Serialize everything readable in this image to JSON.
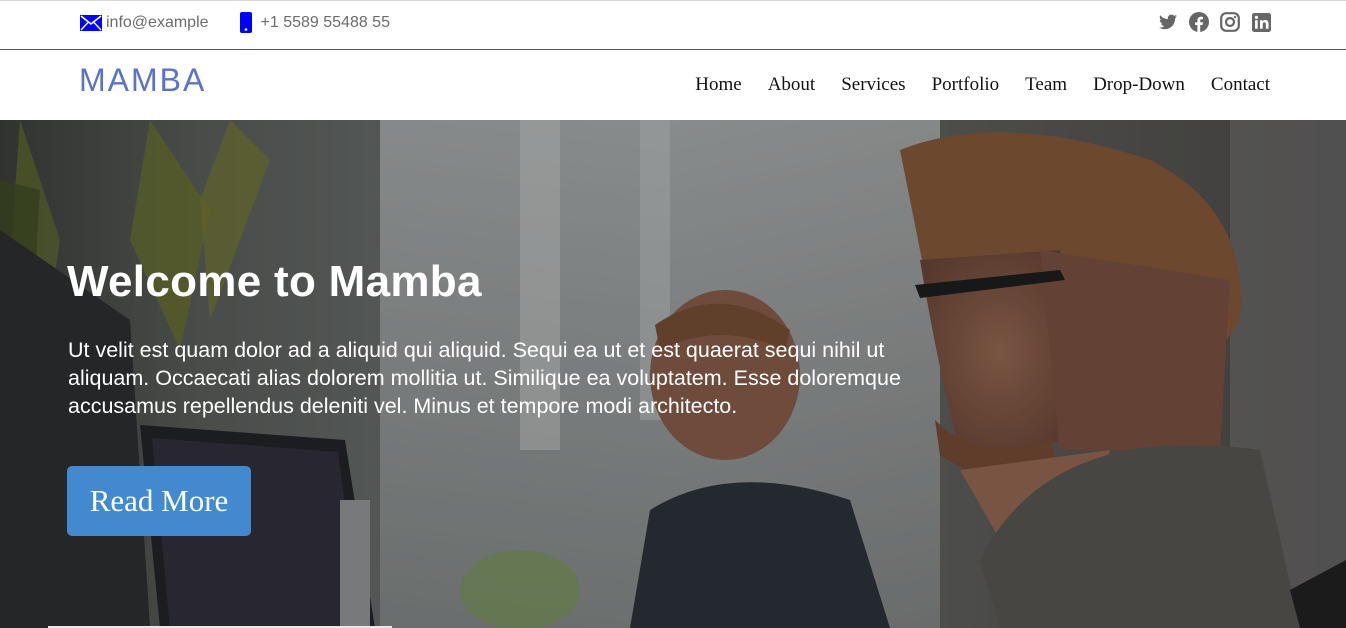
{
  "topbar": {
    "email": "info@example",
    "phone": "+1 5589 55488 55",
    "icons": [
      "envelope-icon",
      "phone-icon"
    ],
    "social": [
      "twitter-icon",
      "facebook-icon",
      "instagram-icon",
      "linkedin-icon"
    ]
  },
  "header": {
    "logo": "MAMBA",
    "nav": [
      "Home",
      "About",
      "Services",
      "Portfolio",
      "Team",
      "Drop-Down",
      "Contact"
    ]
  },
  "hero": {
    "title": "Welcome to Mamba",
    "text": "Ut velit est quam dolor ad a aliquid qui aliquid. Sequi ea ut et est quaerat sequi nihil ut aliquam. Occaecati alias dolorem mollitia ut. Similique ea voluptatem. Esse doloremque accusamus repellendus deleniti vel. Minus et tempore modi architecto.",
    "button": "Read More"
  },
  "colors": {
    "logo": "#5a72c9",
    "button": "#4289d0",
    "contact_icons": "#0000ff",
    "social_icons": "#666666"
  }
}
